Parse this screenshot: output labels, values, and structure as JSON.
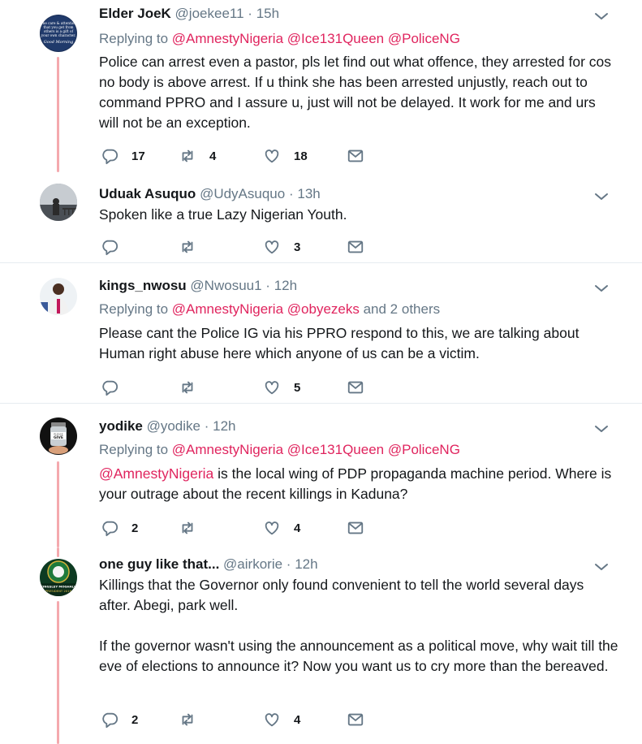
{
  "tweets": [
    {
      "name": "Elder JoeK",
      "handle": "@joekee11",
      "time": "15h",
      "replying_label": "Replying to",
      "mentions": [
        "@AmnestyNigeria",
        "@Ice131Queen",
        "@PoliceNG"
      ],
      "text": "Police can arrest even a pastor, pls let find out what offence, they arrested for cos no body is above arrest. If u think she has been arrested unjustly, reach out to command PPRO and I assure u, just will not be delayed. It work for me and urs will not be an exception.",
      "replies": "17",
      "retweets": "4",
      "likes": "18",
      "avatar_text": [
        "The care & attention",
        "that you get from",
        "others is a gift of",
        "your own character.",
        "Good Morning"
      ]
    },
    {
      "name": "Uduak Asuquo",
      "handle": "@UdyAsuquo",
      "time": "13h",
      "text": "Spoken like a true Lazy Nigerian Youth.",
      "replies": "",
      "retweets": "",
      "likes": "3"
    },
    {
      "name": "kings_nwosu",
      "handle": "@Nwosuu1",
      "time": "12h",
      "replying_label": "Replying to",
      "mentions": [
        "@AmnestyNigeria",
        "@obyezeks"
      ],
      "others": "and 2 others",
      "text": "Please cant the Police IG via his PPRO respond to this, we are talking about Human right abuse  here which anyone of us can be a victim.",
      "replies": "",
      "retweets": "",
      "likes": "5"
    },
    {
      "name": "yodike",
      "handle": "@yodike",
      "time": "12h",
      "replying_label": "Replying to",
      "mentions": [
        "@AmnestyNigeria",
        "@Ice131Queen",
        "@PoliceNG"
      ],
      "text_mention": "@AmnestyNigeria",
      "text": " is the local wing of PDP propaganda machine period. Where is your outrage about the recent killings in Kaduna?",
      "replies": "2",
      "retweets": "",
      "likes": "4",
      "avatar_text": [
        "PLEASE",
        "GIVE"
      ]
    },
    {
      "name": "one guy like that...",
      "handle": "@airkorie",
      "time": "12h",
      "text": "Killings that the Governor only found convenient to tell the world several days after. Abegi, park well.",
      "text2": "If the governor wasn't using the announcement as a political move, why wait till the eve of elections to announce it? Now you want us to cry more than the bereaved.",
      "replies": "2",
      "retweets": "",
      "likes": "4",
      "avatar_text": [
        "KINGSLEY MOGHALU",
        "PRESIDENT 2019"
      ]
    }
  ],
  "colors": {
    "mention": "#e0245e",
    "muted": "#657786",
    "thread": "#f4a9ae",
    "divider": "#e6ecf0"
  }
}
